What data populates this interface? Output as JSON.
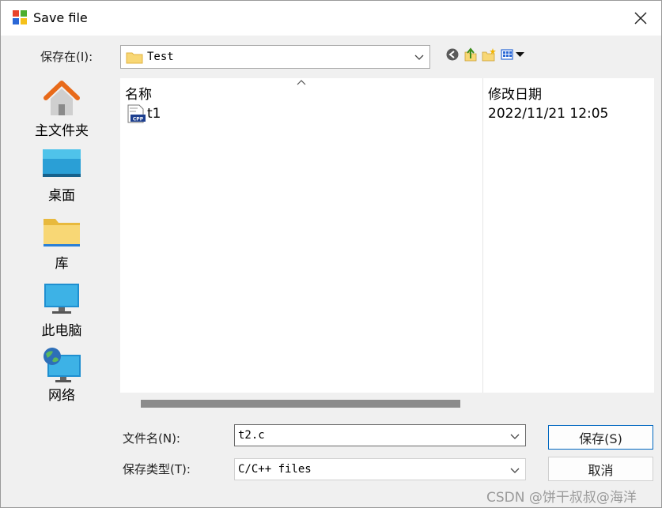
{
  "window": {
    "title": "Save file"
  },
  "save_in": {
    "label": "保存在(I):",
    "location": "Test"
  },
  "places": [
    {
      "label": "主文件夹",
      "icon": "home-icon"
    },
    {
      "label": "桌面",
      "icon": "desktop-icon"
    },
    {
      "label": "库",
      "icon": "library-folder-icon"
    },
    {
      "label": "此电脑",
      "icon": "computer-icon"
    },
    {
      "label": "网络",
      "icon": "network-icon"
    }
  ],
  "file_list": {
    "columns": {
      "name": "名称",
      "modified": "修改日期"
    },
    "rows": [
      {
        "name": "t1",
        "modified": "2022/11/21 12:05",
        "icon": "cpp-file-icon"
      }
    ]
  },
  "filename": {
    "label": "文件名(N):",
    "value": "t2.c"
  },
  "filetype": {
    "label": "保存类型(T):",
    "value": "C/C++ files"
  },
  "buttons": {
    "save": "保存(S)",
    "cancel": "取消"
  },
  "watermark": "CSDN @饼干叔叔@海洋",
  "colors": {
    "accent": "#0067c0",
    "folder": "#f8d775",
    "desktop": "#2a9fd6",
    "scroll_thumb": "#8b8b8b"
  }
}
